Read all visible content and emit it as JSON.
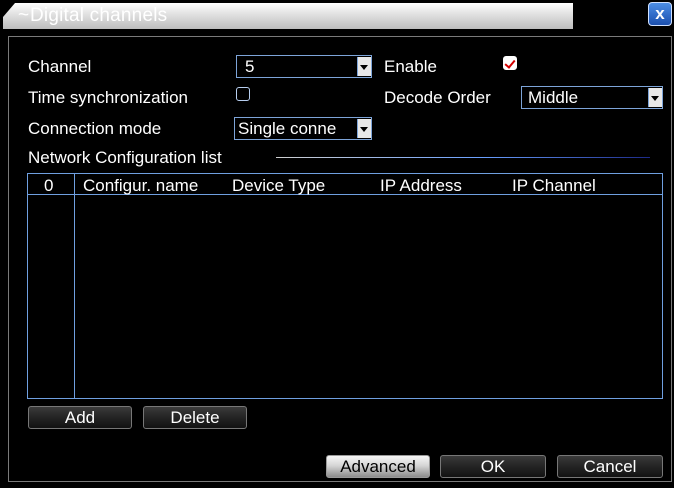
{
  "window": {
    "title": "Digital channels",
    "title_prefix_glyph": "~",
    "close_label": "x",
    "title_bar_color": "#d9d9d9",
    "close_button_color": "#2e6ccc"
  },
  "form": {
    "channel_label": "Channel",
    "channel_value": "5",
    "enable_label": "Enable",
    "enable_checked": true,
    "time_sync_label": "Time synchronization",
    "time_sync_checked": false,
    "decode_order_label": "Decode Order",
    "decode_order_value": "Middle",
    "connection_mode_label": "Connection mode",
    "connection_mode_value": "Single conne"
  },
  "network_list": {
    "section_label": "Network Configuration list",
    "columns": [
      "0",
      "Configur. name",
      "Device Type",
      "IP Address",
      "IP Channel"
    ],
    "rows": []
  },
  "buttons": {
    "add": "Add",
    "delete": "Delete",
    "advanced": "Advanced",
    "ok": "OK",
    "cancel": "Cancel"
  },
  "colors": {
    "background": "#000000",
    "field_border": "#7da4d8",
    "table_border": "#6f9fe0",
    "check_mark": "#d40000"
  }
}
